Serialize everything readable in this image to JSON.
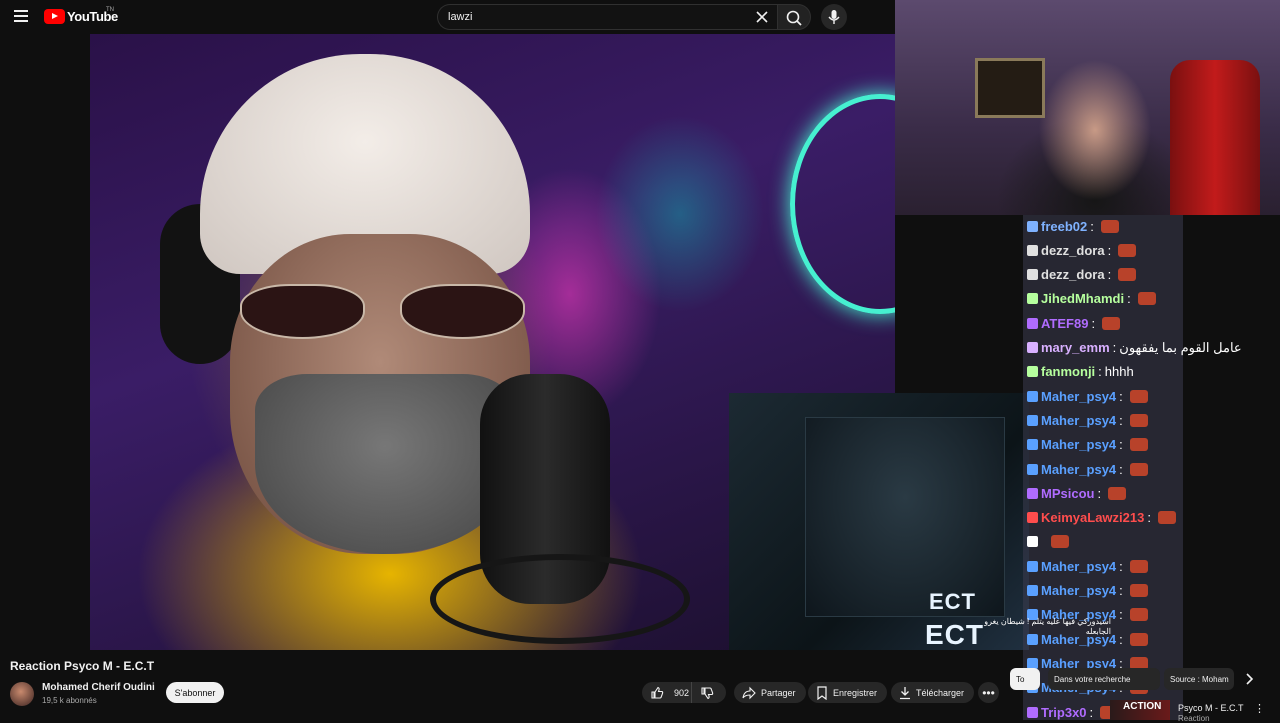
{
  "header": {
    "logo_text": "YouTube",
    "logo_country": "TN",
    "search_value": "lawzi"
  },
  "video": {
    "title": "Reaction Psyco M - E.C.T",
    "thumbnail_text_1": "ECT",
    "thumbnail_text_2": "ECT"
  },
  "chat": {
    "messages": [
      {
        "user": "freeb02",
        "color": "#7fb2ff",
        "text": ""
      },
      {
        "user": "dezz_dora",
        "color": "#e0e0e0",
        "text": ""
      },
      {
        "user": "dezz_dora",
        "color": "#e0e0e0",
        "text": ""
      },
      {
        "user": "JihedMhamdi",
        "color": "#b6ff9e",
        "text": ""
      },
      {
        "user": "ATEF89",
        "color": "#b06cff",
        "text": ""
      },
      {
        "user": "mary_emm",
        "color": "#d8b0ff",
        "text": "عامل القوم بما يفقهون"
      },
      {
        "user": "fanmonji",
        "color": "#b6ff9e",
        "text": "hhhh"
      },
      {
        "user": "Maher_psy4",
        "color": "#5aa0ff",
        "text": ""
      },
      {
        "user": "Maher_psy4",
        "color": "#5aa0ff",
        "text": ""
      },
      {
        "user": "Maher_psy4",
        "color": "#5aa0ff",
        "text": ""
      },
      {
        "user": "Maher_psy4",
        "color": "#5aa0ff",
        "text": ""
      },
      {
        "user": "MPsicou",
        "color": "#b06cff",
        "text": ""
      },
      {
        "user": "KeimyaLawzi213",
        "color": "#ff4d4d",
        "text": ""
      },
      {
        "user": "",
        "color": "#ffffff",
        "text": ""
      },
      {
        "user": "Maher_psy4",
        "color": "#5aa0ff",
        "text": ""
      },
      {
        "user": "Maher_psy4",
        "color": "#5aa0ff",
        "text": ""
      },
      {
        "user": "Maher_psy4",
        "color": "#5aa0ff",
        "text": ""
      },
      {
        "user": "Maher_psy4",
        "color": "#5aa0ff",
        "text": ""
      },
      {
        "user": "Maher_psy4",
        "color": "#5aa0ff",
        "text": ""
      },
      {
        "user": "Maher_psy4",
        "color": "#5aa0ff",
        "text": ""
      },
      {
        "user": "Trip3x0",
        "color": "#b06cff",
        "text": ""
      }
    ],
    "overlay_text": "اسيدوركي فيها عليه يتلم ! شيطان يغرو الجابعله"
  },
  "channel": {
    "name": "Mohamed Cherif Oudini",
    "subscribers": "19,5 k abonnés",
    "subscribe_label": "S'abonner"
  },
  "actions": {
    "likes": "902",
    "share_label": "Partager",
    "save_label": "Enregistrer",
    "download_label": "Télécharger",
    "more_label": "•••"
  },
  "chips": {
    "all_label": "To",
    "chip2_label": "Dans votre recherche",
    "chip3_label": "Source : Moham"
  },
  "recommendation": {
    "thumb_label": "ACTION",
    "title": "Psyco M - E.C.T",
    "subtitle": "Reaction",
    "more_label": "⋮"
  },
  "colors": {
    "brand_red": "#ff0000",
    "background": "#0f0f0f",
    "chip_bg": "#272727"
  }
}
